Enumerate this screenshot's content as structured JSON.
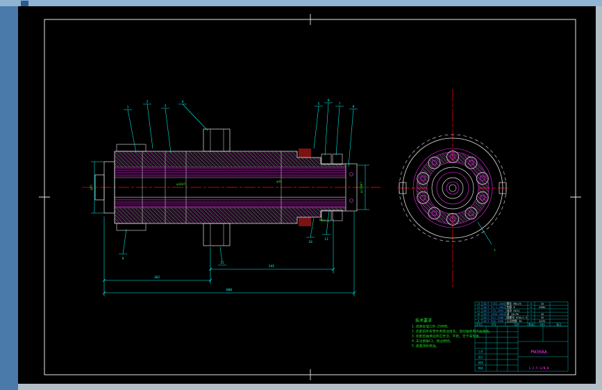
{
  "window": {
    "desktop_color": "#b4bec7",
    "top_strip_color": "#90b4d2",
    "side_strip_color": "#4a7aa9",
    "canvas_color": "#000000"
  },
  "drawing": {
    "centerline_color": "#d40000",
    "outline_color": "#e8e8e8",
    "hatch_color": "#ff2bff",
    "annotation_color": "#00ffff",
    "dim_text_color": "#1ed31e"
  },
  "balloons": {
    "tl": [
      "1",
      "2",
      "3",
      "4"
    ],
    "tr": [
      "5",
      "6",
      "7",
      "8"
    ],
    "bottom": [
      "9",
      "10",
      "11",
      "12"
    ]
  },
  "dims": {
    "d1": "245",
    "d2": "302",
    "overall": "800",
    "left_dia": "φ95",
    "right_dia": "φ110H7",
    "bore1": "φ30H7",
    "bore2": "φ48",
    "thread": "M64×2",
    "view_label": "A"
  },
  "notes": {
    "title": "技术要求",
    "lines": [
      "1.调质处理220-250HB。",
      "2.装配前所有零件用煤油清洗，滚动轴承用汽油清洗。",
      "3.装配后轴承运转应灵活、平稳，无卡滞现象。",
      "4.未注倒角C1，锐边倒钝。",
      "5.表面涂防锈油。"
    ]
  },
  "parts_table": {
    "header": {
      "idx": "序号",
      "code": "代号",
      "name": "名称",
      "qty": "数量",
      "mat": "材料",
      "note": "备注"
    },
    "rows": [
      {
        "idx": "13",
        "code": "GB/T 5783-2000",
        "name": "螺栓 M8×25",
        "qty": "6",
        "mat": "35"
      },
      {
        "idx": "12",
        "code": "GB/T 97.1-2002",
        "name": "垫圈 8",
        "qty": "6",
        "mat": "65Mn"
      },
      {
        "idx": "11",
        "code": "GB/T 276-1994",
        "name": "轴承 6012",
        "qty": "2",
        "mat": ""
      },
      {
        "idx": "10",
        "code": "GB/T 1096-2003",
        "name": "键 10×56",
        "qty": "1",
        "mat": "45"
      },
      {
        "idx": "9",
        "code": "GB/T 812-1988",
        "name": "圆螺母 M30×1.5",
        "qty": "1",
        "mat": "35"
      },
      {
        "idx": "8",
        "code": "GB/T 858-1988",
        "name": "止动垫圈 30",
        "qty": "1",
        "mat": "Q235"
      }
    ]
  },
  "title_block": {
    "drawing_no": "PW30AA",
    "scale_line": "1:2.5 G/N.B",
    "left_labels": [
      "工艺",
      "设计",
      "校核",
      "审核"
    ]
  }
}
